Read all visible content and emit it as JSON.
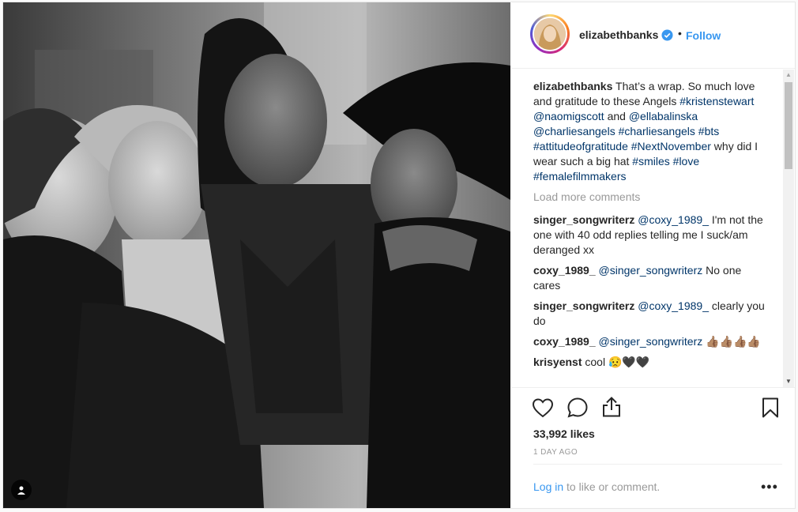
{
  "post": {
    "username": "elizabethbanks",
    "follow_label": "Follow",
    "dot": "•"
  },
  "caption": {
    "username": "elizabethbanks",
    "text_1": " That’s a wrap. So much love and gratitude to these Angels ",
    "tag_1": "#kristenstewart",
    "sep_1": " ",
    "tag_2": "@naomigscott",
    "text_2": " and ",
    "tag_3": "@ellabalinska",
    "sep_2": " ",
    "tag_4": "@charliesangels",
    "sep_3": " ",
    "tag_5": "#charliesangels",
    "sep_4": " ",
    "tag_6": "#bts",
    "sep_5": " ",
    "tag_7": "#attitudeofgratitude",
    "sep_6": " ",
    "tag_8": "#NextNovember",
    "text_3": " why did I wear such a big hat ",
    "tag_9": "#smiles",
    "sep_7": " ",
    "tag_10": "#love",
    "sep_8": " ",
    "tag_11": "#femalefilmmakers"
  },
  "load_more": "Load more comments",
  "comments": [
    {
      "user": "singer_songwriterz",
      "mention": "@coxy_1989_",
      "text": " I'm not the one with 40 odd replies telling me I suck/am deranged xx"
    },
    {
      "user": "coxy_1989_",
      "mention": "@singer_songwriterz",
      "text": " No one cares"
    },
    {
      "user": "singer_songwriterz",
      "mention": "@coxy_1989_",
      "text": " clearly you do"
    },
    {
      "user": "coxy_1989_",
      "mention": "@singer_songwriterz",
      "text": " 👍🏽👍🏽👍🏽👍🏽"
    },
    {
      "user": "krisyenst",
      "mention": "",
      "text": " cool 😥🖤🖤"
    }
  ],
  "likes": "33,992 likes",
  "time": "1 DAY AGO",
  "login": {
    "link": "Log in",
    "rest": " to like or comment.",
    "more": "•••"
  },
  "icons": {
    "like": "heart-icon",
    "comment": "comment-icon",
    "share": "share-icon",
    "save": "bookmark-icon",
    "user_tag": "user-tag-icon"
  },
  "colors": {
    "link": "#3897f0",
    "hashtag": "#003569",
    "muted": "#999999"
  }
}
